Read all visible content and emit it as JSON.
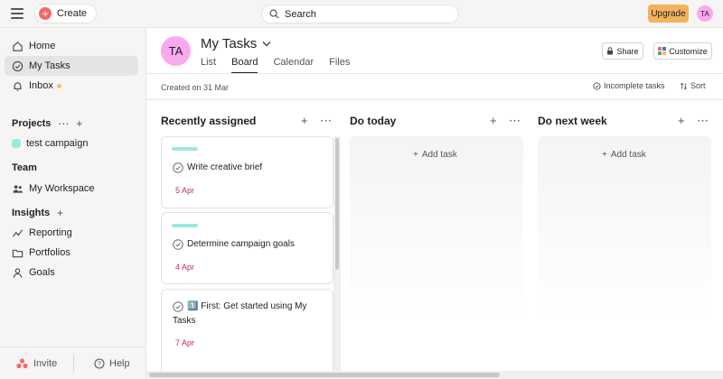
{
  "topbar": {
    "create_label": "Create",
    "search_placeholder": "Search",
    "upgrade_label": "Upgrade",
    "user_initials": "TA"
  },
  "sidebar": {
    "home": "Home",
    "my_tasks": "My Tasks",
    "inbox": "Inbox",
    "projects_title": "Projects",
    "projects_more": "⋯",
    "projects_add": "+",
    "project_name": "test campaign",
    "team_title": "Team",
    "workspace": "My Workspace",
    "insights_title": "Insights",
    "insights_add": "+",
    "reporting": "Reporting",
    "portfolios": "Portfolios",
    "goals": "Goals",
    "invite": "Invite",
    "help": "Help"
  },
  "header": {
    "avatar_initials": "TA",
    "title": "My Tasks",
    "tabs": [
      "List",
      "Board",
      "Calendar",
      "Files"
    ],
    "share_label": "Share",
    "customize_label": "Customize",
    "created_on": "Created on 31 Mar",
    "filter_label": "Incomplete tasks",
    "sort_label": "Sort"
  },
  "board": {
    "add_symbol": "+",
    "more_symbol": "⋯",
    "add_task_label": "Add task",
    "columns": [
      {
        "title": "Recently assigned",
        "tasks": [
          {
            "title": "Write creative brief",
            "due": "5 Apr"
          },
          {
            "title": "Determine campaign goals",
            "due": "4 Apr"
          },
          {
            "emoji": "1️⃣",
            "title_line1": "First: Get started using My",
            "title_line2": "Tasks",
            "due": "7 Apr"
          }
        ]
      },
      {
        "title": "Do today"
      },
      {
        "title": "Do next week"
      }
    ]
  },
  "colors": {
    "brand_coral": "#f06a6a",
    "upgrade": "#f2b35c",
    "avatar": "#f9aaef",
    "project_tag": "#9ee7e3",
    "due_date": "#c92f54"
  }
}
